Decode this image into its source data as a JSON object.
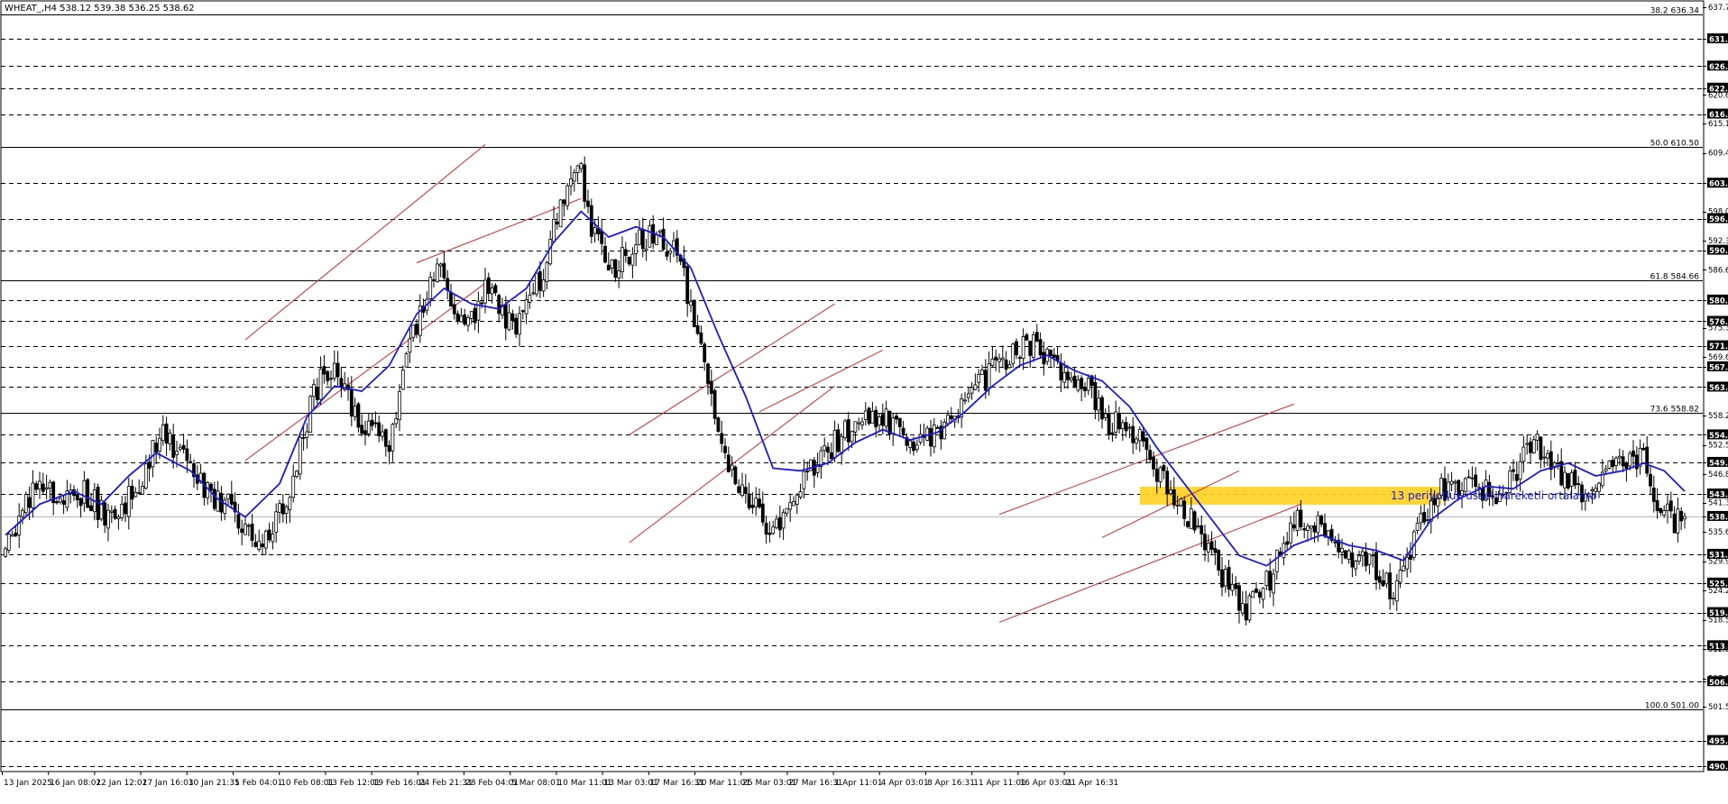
{
  "header": {
    "symbol_line": "WHEAT_,H4  538.12 539.38 536.25 538.62"
  },
  "annotation": {
    "ema_label": "13 periyotluk üssel hareketli ortalama"
  },
  "colors": {
    "background": "#ffffff",
    "candle": "#000000",
    "ema": "#1a1adf",
    "channel": "#d62a2a",
    "zone": "#ffd21f",
    "grid": "#000000",
    "price_box": "#000000",
    "price_text": "#ffffff"
  },
  "chart_data": {
    "type": "candlestick",
    "instrument": "WHEAT_",
    "timeframe": "H4",
    "last_bar": {
      "open": 538.12,
      "high": 539.38,
      "low": 536.25,
      "close": 538.62
    },
    "ylim": [
      490.0,
      637.75
    ],
    "y_tick_labels": [
      "637.75",
      "631.60",
      "626.30",
      "622.00",
      "620.65",
      "616.95",
      "615.10",
      "609.40",
      "603.50",
      "598.00",
      "596.60",
      "592.30",
      "590.45",
      "586.60",
      "580.75",
      "576.60",
      "575.35",
      "571.85",
      "569.65",
      "567.75",
      "563.80",
      "558.25",
      "554.50",
      "552.55",
      "549.15",
      "546.85",
      "543.00",
      "541.30",
      "538.62",
      "535.60",
      "531.25",
      "529.90",
      "525.65",
      "524.20",
      "519.90",
      "518.50",
      "513.45",
      "512.80",
      "507.10",
      "506.45",
      "501.55",
      "495.00",
      "490.00"
    ],
    "dashed_levels": [
      631.6,
      626.3,
      622.0,
      616.95,
      603.5,
      596.6,
      590.45,
      580.75,
      576.6,
      571.85,
      567.75,
      563.8,
      554.5,
      549.15,
      543.0,
      531.25,
      525.65,
      519.9,
      513.45,
      506.45,
      495.0,
      490.0
    ],
    "highlighted_labels": [
      "631.60",
      "626.30",
      "622.00",
      "616.95",
      "603.50",
      "596.60",
      "590.45",
      "580.75",
      "576.60",
      "571.85",
      "567.75",
      "563.80",
      "554.50",
      "549.15",
      "543.00",
      "538.62",
      "531.25",
      "525.65",
      "519.90",
      "513.45",
      "506.45",
      "495.00",
      "490.00"
    ],
    "current_price": 538.62,
    "fibonacci": [
      {
        "label": "38.2 636.34",
        "value": 636.34
      },
      {
        "label": "50.0 610.50",
        "value": 610.5
      },
      {
        "label": "61.8 584.66",
        "value": 584.66
      },
      {
        "label": "73.6 558.82",
        "value": 558.82
      },
      {
        "label": "100.0 501.00",
        "value": 501.0
      }
    ],
    "x_tick_labels": [
      "13 Jan 2025",
      "16 Jan 08:01",
      "22 Jan 12:01",
      "27 Jan 16:01",
      "30 Jan 21:31",
      "5 Feb 04:01",
      "10 Feb 08:01",
      "13 Feb 12:01",
      "19 Feb 16:01",
      "24 Feb 21:31",
      "28 Feb 04:01",
      "5 Mar 08:01",
      "10 Mar 11:01",
      "13 Mar 03:01",
      "17 Mar 16:31",
      "20 Mar 11:01",
      "25 Mar 03:01",
      "27 Mar 16:31",
      "1 Apr 11:01",
      "4 Apr 03:01",
      "8 Apr 16:31",
      "11 Apr 11:01",
      "16 Apr 03:01",
      "21 Apr 16:31"
    ],
    "bar_count": 304,
    "price_path": [
      [
        0,
        531.0
      ],
      [
        4,
        543.5
      ],
      [
        12,
        543.0
      ],
      [
        16,
        536.5
      ],
      [
        20,
        547.0
      ],
      [
        23,
        556.0
      ],
      [
        28,
        545.0
      ],
      [
        33,
        540.0
      ],
      [
        37,
        532.0
      ],
      [
        41,
        542.0
      ],
      [
        45,
        563.0
      ],
      [
        48,
        568.0
      ],
      [
        52,
        556.0
      ],
      [
        56,
        554.0
      ],
      [
        59,
        572.0
      ],
      [
        63,
        588.0
      ],
      [
        67,
        574.0
      ],
      [
        70,
        583.0
      ],
      [
        74,
        575.0
      ],
      [
        78,
        585.0
      ],
      [
        82,
        604.0
      ],
      [
        84,
        606.0
      ],
      [
        85,
        597.0
      ],
      [
        88,
        586.0
      ],
      [
        91,
        590.0
      ],
      [
        94,
        594.0
      ],
      [
        98,
        589.0
      ],
      [
        101,
        575.0
      ],
      [
        105,
        550.0
      ],
      [
        109,
        542.0
      ],
      [
        112,
        534.5
      ],
      [
        117,
        548.0
      ],
      [
        121,
        553.0
      ],
      [
        125,
        558.0
      ],
      [
        129,
        557.0
      ],
      [
        133,
        553.0
      ],
      [
        137,
        556.0
      ],
      [
        141,
        563.0
      ],
      [
        145,
        568.0
      ],
      [
        149,
        573.0
      ],
      [
        153,
        568.0
      ],
      [
        157,
        566.0
      ],
      [
        161,
        557.0
      ],
      [
        165,
        554.0
      ],
      [
        169,
        546.0
      ],
      [
        173,
        538.0
      ],
      [
        177,
        528.0
      ],
      [
        181,
        521.0
      ],
      [
        183,
        523.0
      ],
      [
        186,
        531.0
      ],
      [
        189,
        539.0
      ],
      [
        194,
        533.0
      ],
      [
        199,
        530.0
      ],
      [
        203,
        523.5
      ],
      [
        207,
        540.0
      ],
      [
        211,
        546.0
      ],
      [
        215,
        543.0
      ],
      [
        219,
        544.0
      ],
      [
        223,
        553.0
      ],
      [
        227,
        547.0
      ],
      [
        231,
        543.0
      ],
      [
        235,
        549.0
      ],
      [
        239,
        551.0
      ],
      [
        241,
        541.0
      ],
      [
        243,
        538.0
      ],
      [
        245,
        538.62
      ]
    ],
    "ema13": [
      [
        0,
        535.0
      ],
      [
        5,
        541.0
      ],
      [
        10,
        543.5
      ],
      [
        14,
        541.0
      ],
      [
        18,
        546.5
      ],
      [
        22,
        551.0
      ],
      [
        27,
        547.5
      ],
      [
        31,
        542.0
      ],
      [
        35,
        538.5
      ],
      [
        40,
        545.0
      ],
      [
        44,
        558.0
      ],
      [
        48,
        564.0
      ],
      [
        52,
        563.0
      ],
      [
        56,
        568.0
      ],
      [
        60,
        578.0
      ],
      [
        64,
        583.0
      ],
      [
        68,
        580.0
      ],
      [
        72,
        579.0
      ],
      [
        76,
        583.0
      ],
      [
        80,
        592.0
      ],
      [
        84,
        598.0
      ],
      [
        88,
        593.0
      ],
      [
        92,
        595.0
      ],
      [
        96,
        593.0
      ],
      [
        100,
        587.0
      ],
      [
        104,
        574.0
      ],
      [
        108,
        562.0
      ],
      [
        112,
        548.0
      ],
      [
        116,
        547.5
      ],
      [
        120,
        549.0
      ],
      [
        124,
        553.0
      ],
      [
        128,
        555.5
      ],
      [
        132,
        553.5
      ],
      [
        136,
        555.0
      ],
      [
        140,
        559.0
      ],
      [
        144,
        564.0
      ],
      [
        148,
        568.0
      ],
      [
        152,
        570.0
      ],
      [
        156,
        567.0
      ],
      [
        160,
        565.0
      ],
      [
        164,
        560.0
      ],
      [
        168,
        552.0
      ],
      [
        172,
        545.0
      ],
      [
        176,
        538.0
      ],
      [
        180,
        531.0
      ],
      [
        184,
        529.0
      ],
      [
        188,
        533.0
      ],
      [
        192,
        535.0
      ],
      [
        196,
        533.0
      ],
      [
        200,
        532.0
      ],
      [
        204,
        530.0
      ],
      [
        208,
        538.0
      ],
      [
        212,
        542.0
      ],
      [
        216,
        544.5
      ],
      [
        220,
        544.0
      ],
      [
        224,
        547.5
      ],
      [
        228,
        549.0
      ],
      [
        232,
        546.5
      ],
      [
        236,
        547.5
      ],
      [
        239,
        549.0
      ],
      [
        242,
        547.5
      ],
      [
        245,
        543.5
      ]
    ],
    "channels": [
      {
        "lines": [
          [
            [
              35,
              573.0
            ],
            [
              70,
              611.0
            ]
          ],
          [
            [
              35,
              549.5
            ],
            [
              70,
              584.0
            ]
          ]
        ]
      },
      {
        "lines": [
          [
            [
              91,
              554.5
            ],
            [
              121,
              580.0
            ]
          ],
          [
            [
              91,
              533.5
            ],
            [
              121,
              564.0
            ]
          ]
        ]
      },
      {
        "lines": [
          [
            [
              145,
              539.0
            ],
            [
              188,
              560.5
            ]
          ],
          [
            [
              145,
              518.0
            ],
            [
              189,
              541.0
            ]
          ]
        ]
      }
    ],
    "inner_lines": [
      [
        [
          60,
          588.0
        ],
        [
          84,
          600.5
        ]
      ],
      [
        [
          110,
          559.0
        ],
        [
          128,
          571.0
        ]
      ],
      [
        [
          160,
          534.5
        ],
        [
          180,
          547.5
        ]
      ]
    ],
    "zone": {
      "x0": 165.5,
      "x1": 209.5,
      "y_top": 544.4,
      "y_bottom": 540.9
    }
  }
}
